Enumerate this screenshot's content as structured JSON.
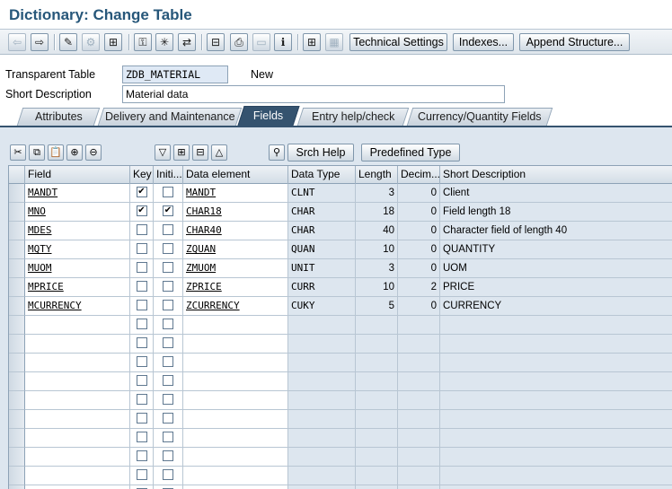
{
  "window": {
    "title": "Dictionary: Change Table"
  },
  "toolbar": {
    "icons": [
      {
        "name": "back-arrow-icon",
        "glyph": "⇦",
        "disabled": true
      },
      {
        "name": "forward-arrow-icon",
        "glyph": "⇨",
        "disabled": false
      },
      {
        "name": "display-change-icon",
        "glyph": "✎",
        "disabled": false
      },
      {
        "name": "other-object-icon",
        "glyph": "⚙",
        "disabled": true
      },
      {
        "name": "check-icon",
        "glyph": "⊞",
        "disabled": false
      },
      {
        "name": "activate-icon",
        "glyph": "⚿",
        "disabled": false
      },
      {
        "name": "where-used-icon",
        "glyph": "✳",
        "disabled": false
      },
      {
        "name": "navigation-icon",
        "glyph": "⇄",
        "disabled": false
      },
      {
        "name": "hierarchy-icon",
        "glyph": "⊟",
        "disabled": false
      },
      {
        "name": "print-icon",
        "glyph": "⎙",
        "disabled": false
      },
      {
        "name": "empty-frame-icon",
        "glyph": "▭",
        "disabled": true
      },
      {
        "name": "info-icon",
        "glyph": "ℹ",
        "disabled": false
      },
      {
        "name": "tree-icon",
        "glyph": "⊞",
        "disabled": false
      },
      {
        "name": "grid-icon",
        "glyph": "▦",
        "disabled": true
      }
    ],
    "technical_settings": "Technical Settings",
    "indexes": "Indexes...",
    "append_structure": "Append Structure..."
  },
  "header": {
    "table_type_label": "Transparent Table",
    "table_name": "ZDB_MATERIAL",
    "status": "New",
    "short_desc_label": "Short Description",
    "short_desc_value": "Material data"
  },
  "tabs": [
    {
      "label": "Attributes",
      "active": false
    },
    {
      "label": "Delivery and Maintenance",
      "active": false
    },
    {
      "label": "Fields",
      "active": true
    },
    {
      "label": "Entry help/check",
      "active": false
    },
    {
      "label": "Currency/Quantity Fields",
      "active": false
    }
  ],
  "grid_toolbar": {
    "icons": [
      {
        "name": "cut-icon",
        "glyph": "✂"
      },
      {
        "name": "copy-icon",
        "glyph": "⧉"
      },
      {
        "name": "paste-icon",
        "glyph": "📋"
      },
      {
        "name": "insert-row-icon",
        "glyph": "⊕"
      },
      {
        "name": "delete-row-icon",
        "glyph": "⊖"
      },
      {
        "name": "filter-icon",
        "glyph": "▽"
      },
      {
        "name": "insert-field-icon",
        "glyph": "⊞"
      },
      {
        "name": "delete-field-icon",
        "glyph": "⊟"
      },
      {
        "name": "sort-up-icon",
        "glyph": "△"
      },
      {
        "name": "search-help-icon",
        "glyph": "⚲"
      }
    ],
    "srch_help": "Srch Help",
    "predefined_type": "Predefined Type"
  },
  "grid": {
    "headers": [
      "Field",
      "Key",
      "Initi...",
      "Data element",
      "Data Type",
      "Length",
      "Decim...",
      "Short Description"
    ],
    "rows": [
      {
        "field": "MANDT",
        "key": true,
        "initial": false,
        "data_element": "MANDT",
        "data_type": "CLNT",
        "length": "3",
        "decimals": "0",
        "description": "Client"
      },
      {
        "field": "MNO",
        "key": true,
        "initial": true,
        "data_element": "CHAR18",
        "data_type": "CHAR",
        "length": "18",
        "decimals": "0",
        "description": "Field length 18"
      },
      {
        "field": "MDES",
        "key": false,
        "initial": false,
        "data_element": "CHAR40",
        "data_type": "CHAR",
        "length": "40",
        "decimals": "0",
        "description": "Character field of length 40"
      },
      {
        "field": "MQTY",
        "key": false,
        "initial": false,
        "data_element": "ZQUAN",
        "data_type": "QUAN",
        "length": "10",
        "decimals": "0",
        "description": "QUANTITY"
      },
      {
        "field": "MUOM",
        "key": false,
        "initial": false,
        "data_element": "ZMUOM",
        "data_type": "UNIT",
        "length": "3",
        "decimals": "0",
        "description": "UOM"
      },
      {
        "field": "MPRICE",
        "key": false,
        "initial": false,
        "data_element": "ZPRICE",
        "data_type": "CURR",
        "length": "10",
        "decimals": "2",
        "description": "PRICE"
      },
      {
        "field": "MCURRENCY",
        "key": false,
        "initial": false,
        "data_element": "ZCURRENCY",
        "data_type": "CUKY",
        "length": "5",
        "decimals": "0",
        "description": "CURRENCY"
      }
    ],
    "empty_rows": 10
  }
}
